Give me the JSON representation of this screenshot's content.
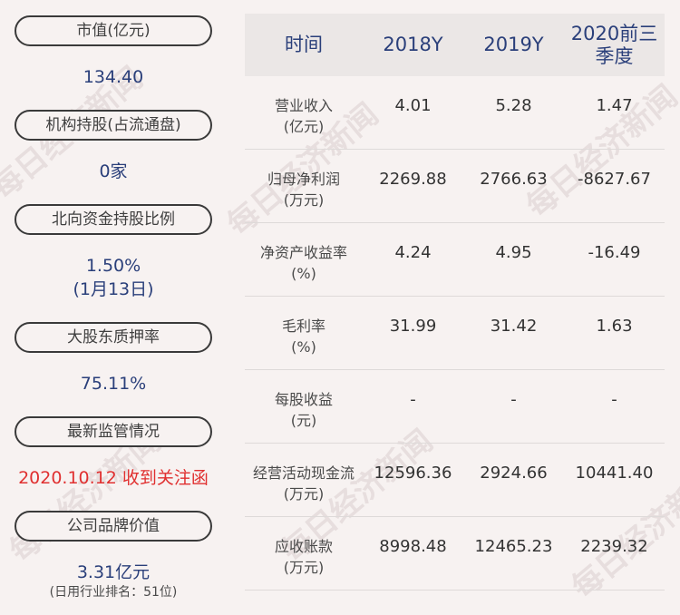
{
  "left": {
    "items": [
      {
        "label": "市值(亿元)",
        "value": "134.40"
      },
      {
        "label": "机构持股(占流通盘)",
        "value": "0家"
      },
      {
        "label": "北向资金持股比例",
        "value": "1.50%",
        "value2": "(1月13日)"
      },
      {
        "label": "大股东质押率",
        "value": "75.11%"
      },
      {
        "label": "最新监管情况",
        "value": "2020.10.12 收到关注函"
      },
      {
        "label": "公司品牌价值",
        "value": "3.31亿元",
        "note": "(日用行业排名：51位)"
      }
    ]
  },
  "table": {
    "headers": [
      "时间",
      "2018Y",
      "2019Y",
      "2020前三季度"
    ],
    "rows": [
      {
        "label": "营业收入",
        "unit": "(亿元)",
        "values": [
          "4.01",
          "5.28",
          "1.47"
        ]
      },
      {
        "label": "归母净利润",
        "unit": "(万元)",
        "values": [
          "2269.88",
          "2766.63",
          "-8627.67"
        ]
      },
      {
        "label": "净资产收益率",
        "unit": "(%)",
        "values": [
          "4.24",
          "4.95",
          "-16.49"
        ]
      },
      {
        "label": "毛利率",
        "unit": "(%)",
        "values": [
          "31.99",
          "31.42",
          "1.63"
        ]
      },
      {
        "label": "每股收益",
        "unit": "(元)",
        "values": [
          "-",
          "-",
          "-"
        ]
      },
      {
        "label": "经营活动现金流",
        "unit": "(万元)",
        "values": [
          "12596.36",
          "2924.66",
          "10441.40"
        ]
      },
      {
        "label": "应收账款",
        "unit": "(万元)",
        "values": [
          "8998.48",
          "12465.23",
          "2239.32"
        ]
      }
    ]
  },
  "watermark": {
    "text": "每日经济新闻"
  },
  "colors": {
    "background": "#f7f2f1",
    "value_blue": "#2a3f7a",
    "alert_red": "#e03030",
    "header_bg": "#ebe7e6"
  }
}
